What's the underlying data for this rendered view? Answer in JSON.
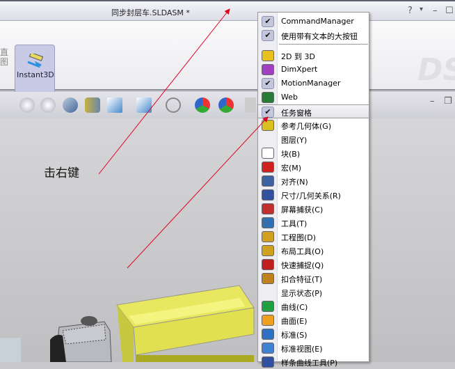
{
  "window": {
    "title": "同步封层车.SLDASM *",
    "help": "?",
    "dropdown": "▾",
    "minimize": "–",
    "maximize": "☐",
    "restore": "❐"
  },
  "ribbon": {
    "left_label": "直图",
    "instant3d": "Instant3D"
  },
  "annotation": {
    "text": "击右键"
  },
  "menu": {
    "top": [
      {
        "label": "CommandManager",
        "checked": true
      },
      {
        "label": "使用带有文本的大按钮",
        "checked": true
      }
    ],
    "items": [
      {
        "label": "2D 到 3D",
        "icon": "2d-to-3d-icon",
        "color": "#e8c020"
      },
      {
        "label": "DimXpert",
        "icon": "dimxpert-icon",
        "color": "#a040c0"
      },
      {
        "label": "MotionManager",
        "checked": true
      },
      {
        "label": "Web",
        "icon": "globe-icon",
        "color": "#2a7a3a"
      },
      {
        "label": "任务窗格",
        "checked": true,
        "highlighted": true
      },
      {
        "label": "参考几何体(G)",
        "icon": "reference-geometry-icon",
        "color": "#d8c020"
      },
      {
        "label": "图层(Y)",
        "icon": ""
      },
      {
        "label": "块(B)",
        "icon": "block-icon",
        "color": "#ffffff"
      },
      {
        "label": "宏(M)",
        "icon": "macro-icon",
        "color": "#d02020"
      },
      {
        "label": "对齐(N)",
        "icon": "align-icon",
        "color": "#4060a0"
      },
      {
        "label": "尺寸/几何关系(R)",
        "icon": "dimension-icon",
        "color": "#3050a0"
      },
      {
        "label": "屏幕捕获(C)",
        "icon": "screen-capture-icon",
        "color": "#c03030"
      },
      {
        "label": "工具(T)",
        "icon": "tools-icon",
        "color": "#3070b0"
      },
      {
        "label": "工程图(D)",
        "icon": "drawing-icon",
        "color": "#d0a020"
      },
      {
        "label": "布局工具(O)",
        "icon": "layout-tools-icon",
        "color": "#d0a020"
      },
      {
        "label": "快速捕捉(Q)",
        "icon": "quick-snap-icon",
        "color": "#c02020"
      },
      {
        "label": "扣合特征(T)",
        "icon": "fastening-features-icon",
        "color": "#c08020"
      },
      {
        "label": "显示状态(P)",
        "icon": ""
      },
      {
        "label": "曲线(C)",
        "icon": "curves-icon",
        "color": "#20a040"
      },
      {
        "label": "曲面(E)",
        "icon": "surfaces-icon",
        "color": "#f0a020"
      },
      {
        "label": "标准(S)",
        "icon": "standard-icon",
        "color": "#3070c0"
      },
      {
        "label": "标准视图(E)",
        "icon": "standard-views-icon",
        "color": "#4080d0"
      },
      {
        "label": "样条曲线工具(P)",
        "icon": "spline-tools-icon",
        "color": "#3050a0"
      }
    ]
  },
  "colors": {
    "arrow": "#e00020",
    "model_yellow": "#e8e860"
  }
}
